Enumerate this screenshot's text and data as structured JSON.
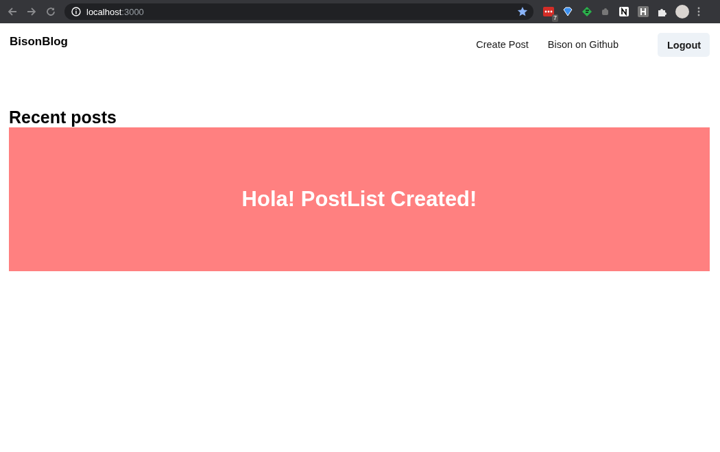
{
  "browser": {
    "url_host": "localhost",
    "url_port": ":3000",
    "bookmarked": true,
    "extension_badge": "7"
  },
  "header": {
    "brand": "BisonBlog",
    "links": [
      "Create Post",
      "Bison on Github"
    ],
    "button": "Logout"
  },
  "main": {
    "heading": "Recent posts",
    "banner": "Hola! PostList Created!"
  }
}
